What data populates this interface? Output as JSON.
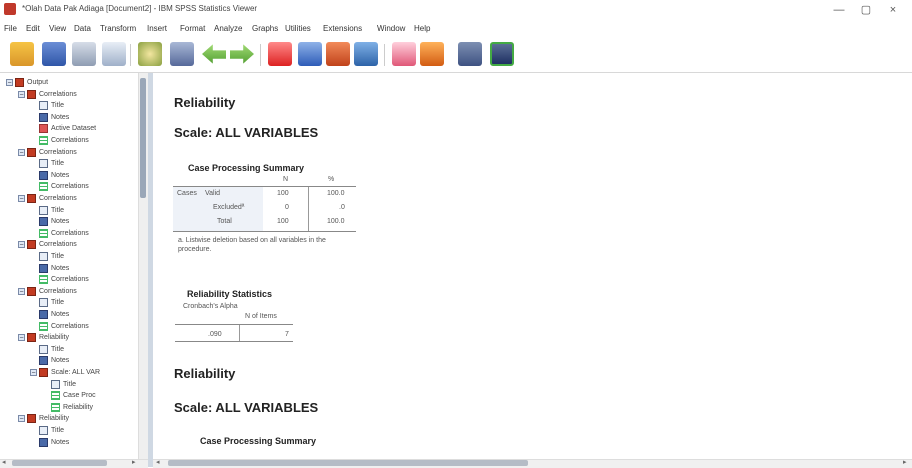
{
  "window": {
    "title": "*Olah Data Pak Adiaga [Document2] - IBM SPSS Statistics Viewer",
    "minimize": "—",
    "maximize": "▢",
    "close": "×"
  },
  "menu": [
    "File",
    "Edit",
    "View",
    "Data",
    "Transform",
    "Insert",
    "Format",
    "Analyze",
    "Graphs",
    "Utilities",
    "Extensions",
    "Window",
    "Help"
  ],
  "toolbar_icons": [
    "open-icon",
    "save-icon",
    "print-icon",
    "print-preview-icon",
    "export-icon",
    "recall-dialog-icon",
    "undo-icon",
    "redo-icon",
    "goto-data-icon",
    "goto-case-icon",
    "goto-variable-icon",
    "variables-icon",
    "show-output-icon",
    "hide-output-icon",
    "collapse-icon",
    "expand-icon"
  ],
  "outline": [
    {
      "label": "Output",
      "icon": "book",
      "level": 0,
      "expander": "−"
    },
    {
      "label": "Correlations",
      "icon": "book",
      "level": 1,
      "expander": "−"
    },
    {
      "label": "Title",
      "icon": "title",
      "level": 2
    },
    {
      "label": "Notes",
      "icon": "notes",
      "level": 2
    },
    {
      "label": "Active Dataset",
      "icon": "data",
      "level": 2
    },
    {
      "label": "Correlations",
      "icon": "table",
      "level": 2
    },
    {
      "label": "Correlations",
      "icon": "book",
      "level": 1,
      "expander": "−"
    },
    {
      "label": "Title",
      "icon": "title",
      "level": 2
    },
    {
      "label": "Notes",
      "icon": "notes",
      "level": 2
    },
    {
      "label": "Correlations",
      "icon": "table",
      "level": 2
    },
    {
      "label": "Correlations",
      "icon": "book",
      "level": 1,
      "expander": "−"
    },
    {
      "label": "Title",
      "icon": "title",
      "level": 2
    },
    {
      "label": "Notes",
      "icon": "notes",
      "level": 2
    },
    {
      "label": "Correlations",
      "icon": "table",
      "level": 2
    },
    {
      "label": "Correlations",
      "icon": "book",
      "level": 1,
      "expander": "−"
    },
    {
      "label": "Title",
      "icon": "title",
      "level": 2
    },
    {
      "label": "Notes",
      "icon": "notes",
      "level": 2
    },
    {
      "label": "Correlations",
      "icon": "table",
      "level": 2
    },
    {
      "label": "Correlations",
      "icon": "book",
      "level": 1,
      "expander": "−"
    },
    {
      "label": "Title",
      "icon": "title",
      "level": 2
    },
    {
      "label": "Notes",
      "icon": "notes",
      "level": 2
    },
    {
      "label": "Correlations",
      "icon": "table",
      "level": 2
    },
    {
      "label": "Reliability",
      "icon": "book",
      "level": 1,
      "expander": "−"
    },
    {
      "label": "Title",
      "icon": "title",
      "level": 2
    },
    {
      "label": "Notes",
      "icon": "notes",
      "level": 2
    },
    {
      "label": "Scale: ALL VAR",
      "icon": "book",
      "level": 2,
      "expander": "−"
    },
    {
      "label": "Title",
      "icon": "title",
      "level": 3
    },
    {
      "label": "Case Proc",
      "icon": "table",
      "level": 3
    },
    {
      "label": "Reliability",
      "icon": "table",
      "level": 3
    },
    {
      "label": "Reliability",
      "icon": "book",
      "level": 1,
      "expander": "−"
    },
    {
      "label": "Title",
      "icon": "title",
      "level": 2
    },
    {
      "label": "Notes",
      "icon": "notes",
      "level": 2
    }
  ],
  "content": {
    "section1": {
      "heading": "Reliability",
      "scale": "Scale: ALL VARIABLES",
      "case_summary": {
        "title": "Case Processing Summary",
        "col_headers": [
          "N",
          "%"
        ],
        "group_label": "Cases",
        "rows": [
          {
            "label": "Valid",
            "n": "100",
            "pct": "100.0"
          },
          {
            "label": "Excludedª",
            "n": "0",
            "pct": ".0"
          },
          {
            "label": "Total",
            "n": "100",
            "pct": "100.0"
          }
        ],
        "footnote": "a. Listwise deletion based on all variables in the procedure."
      },
      "reliability_stats": {
        "title": "Reliability Statistics",
        "col_headers": [
          "Cronbach's Alpha",
          "N of Items"
        ],
        "values": [
          ".090",
          "7"
        ]
      }
    },
    "section2": {
      "heading": "Reliability",
      "scale": "Scale: ALL VARIABLES",
      "case_summary_title": "Case Processing Summary"
    }
  }
}
